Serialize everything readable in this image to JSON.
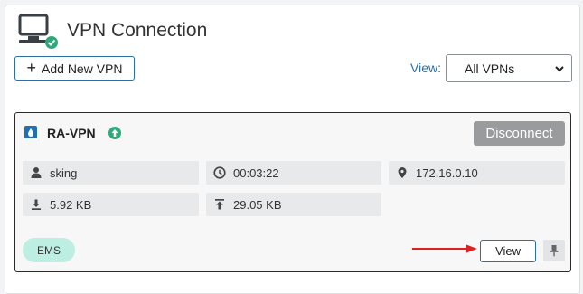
{
  "header": {
    "title": "VPN Connection",
    "icon": "vpn-monitor-check-icon"
  },
  "toolbar": {
    "add_label": "Add New VPN",
    "view_label": "View:",
    "view_selected": "All VPNs"
  },
  "connection": {
    "name": "RA-VPN",
    "disconnect_label": "Disconnect",
    "user": "sking",
    "duration": "00:03:22",
    "ip": "172.16.0.10",
    "received": "5.92 KB",
    "sent": "29.05 KB",
    "badge": "EMS",
    "view_label": "View"
  },
  "colors": {
    "accent": "#2a6fa8",
    "status_up": "#2fa87a",
    "disconnect_bg": "#9a9b9d",
    "ems_badge": "#bdeee2",
    "annotation_arrow": "#e02020"
  }
}
